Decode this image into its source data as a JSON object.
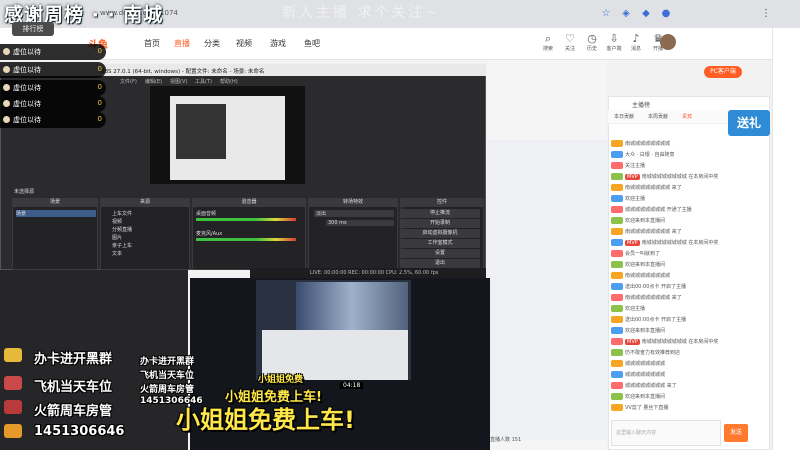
{
  "overlay": {
    "title": "感谢周榜 · · 南城",
    "subtitle": "新人主播 求个关注~",
    "rank_tab": "排行榜",
    "rank_rows": [
      {
        "name": "虚位以待",
        "score": "0"
      },
      {
        "name": "虚位以待",
        "score": "0"
      },
      {
        "name": "虚位以待",
        "score": "0"
      },
      {
        "name": "虚位以待",
        "score": "0"
      },
      {
        "name": "虚位以待",
        "score": "0"
      }
    ],
    "promo_lines": [
      "办卡进开黑群",
      "飞机当天车位",
      "火箭周车房管",
      "1451306646"
    ],
    "promo_small": [
      "办卡进开黑群",
      "飞机当天车位",
      "火箭周车房管",
      "1451306646"
    ],
    "car_small": "小姐姐免费",
    "car_mid": "小姐姐免费上车!",
    "car_big": "小姐姐免费上车!"
  },
  "browser": {
    "url": "www.douyu.com/1074"
  },
  "site_nav": {
    "logo": "斗鱼",
    "items": [
      "首页",
      "直播",
      "分类",
      "视频",
      "游戏",
      "鱼吧"
    ],
    "active_index": 1,
    "top_icons": [
      {
        "icon": "search-icon",
        "label": "搜索"
      },
      {
        "icon": "heart-icon",
        "label": "关注"
      },
      {
        "icon": "history-icon",
        "label": "历史"
      },
      {
        "icon": "download-icon",
        "label": "客户端"
      },
      {
        "icon": "bell-icon",
        "label": "消息"
      },
      {
        "icon": "crown-icon",
        "label": "开播"
      }
    ]
  },
  "room_bar": {
    "pc_button": "PC客户端",
    "gift_banner": "送礼",
    "live_label": "主播榜",
    "tabs": [
      "本日贡献",
      "本周贡献",
      "贵宾"
    ]
  },
  "obs": {
    "title": "OBS 27.0.1 (64-bit, windows) - 配置文件: 未命名 - 场景: 未命名",
    "menu": [
      "文件(F)",
      "编辑(E)",
      "视图(V)",
      "工具(T)",
      "帮助(H)"
    ],
    "panels": [
      "场景",
      "来源",
      "混音器",
      "转场特效",
      "控件"
    ],
    "scene": "场景",
    "sources": [
      "上车文件",
      "视频",
      "分频直播",
      "图片",
      "亲子上车",
      "文本"
    ],
    "mixer": [
      "桌面音频",
      "麦克风/Aux"
    ],
    "transition": "淡出",
    "duration": "300 ms",
    "controls": [
      "停止推流",
      "开始录制",
      "启动虚拟摄像机",
      "工作室模式",
      "设置",
      "退出"
    ],
    "status": "LIVE: 00:00:00  REC: 00:00:00  CPU: 2.5%, 60.00 fps",
    "no_source": "未选择源"
  },
  "chat": {
    "messages": [
      {
        "badge": "",
        "text": "南城城城城城城城城"
      },
      {
        "badge": "",
        "text": "大众 · 白银 · 自由随意"
      },
      {
        "badge": "",
        "text": "关注主播"
      },
      {
        "badge": "MVP",
        "text": "南城城城城城城城城 在本房间中奖"
      },
      {
        "badge": "",
        "text": "南城城城城城城城城 来了"
      },
      {
        "badge": "",
        "text": "欢迎主播"
      },
      {
        "badge": "",
        "text": "城城城城城城城城 开通了主播"
      },
      {
        "badge": "",
        "text": "欢迎来到本直播间"
      },
      {
        "badge": "",
        "text": "南城城城城城城城城 来了"
      },
      {
        "badge": "MVP",
        "text": "南城城城城城城城城 在本房间中奖"
      },
      {
        "badge": "",
        "text": "会员一叫就到了"
      },
      {
        "badge": "",
        "text": "欢迎来到本直播间"
      },
      {
        "badge": "",
        "text": "南城城城城城城城城"
      },
      {
        "badge": "",
        "text": "送出00:00点卡 开启了主播"
      },
      {
        "badge": "",
        "text": "南城城城城城城城城 来了"
      },
      {
        "badge": "",
        "text": "欢迎主播"
      },
      {
        "badge": "",
        "text": "送出00:00点卡 开启了主播"
      },
      {
        "badge": "",
        "text": "欢迎来到本直播间"
      },
      {
        "badge": "MVP",
        "text": "南城城城城城城城城 在本房间中奖"
      },
      {
        "badge": "",
        "text": "仍不敢奋力有效推荐到店"
      },
      {
        "badge": "",
        "text": "城城城城城城城城"
      },
      {
        "badge": "",
        "text": "城城城城城城城城"
      },
      {
        "badge": "",
        "text": "城城城城城城城城 来了"
      },
      {
        "badge": "",
        "text": "欢迎来到本直播间"
      },
      {
        "badge": "",
        "text": "VV剪了 量丝下直播"
      }
    ],
    "input_placeholder": "这里输入聊天内容",
    "send_label": "发送",
    "stream_counts": [
      "04:18",
      "直播人数 151"
    ]
  }
}
